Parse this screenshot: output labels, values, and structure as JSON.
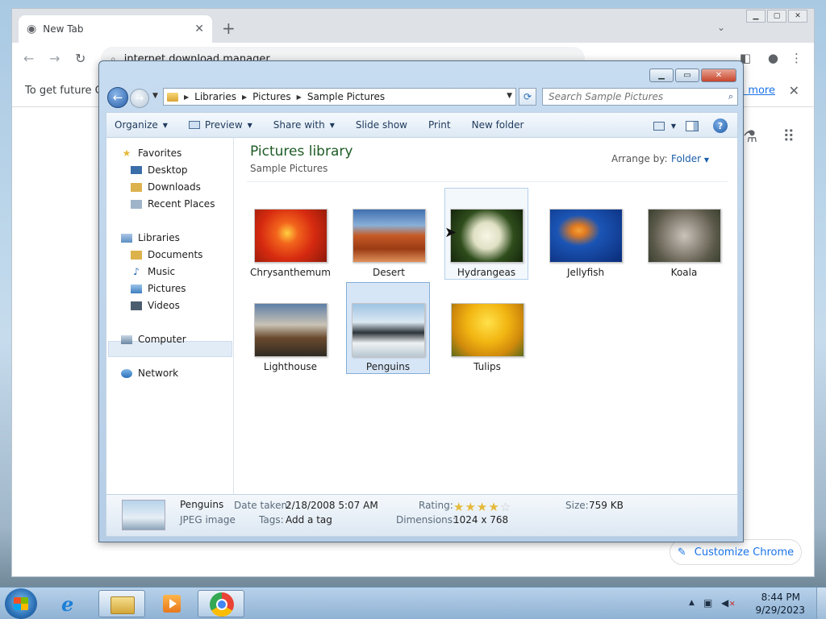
{
  "chrome": {
    "tab_title": "New Tab",
    "omnibox_text": "internet download manager",
    "info_message": "To get future Go",
    "info_link": "rn more",
    "customize_label": "Customize Chrome"
  },
  "explorer": {
    "breadcrumbs": [
      "Libraries",
      "Pictures",
      "Sample Pictures"
    ],
    "search_placeholder": "Search Sample Pictures",
    "commands": {
      "organize": "Organize",
      "preview": "Preview",
      "share_with": "Share with",
      "slide_show": "Slide show",
      "print": "Print",
      "new_folder": "New folder"
    },
    "nav": {
      "favorites": "Favorites",
      "desktop": "Desktop",
      "downloads": "Downloads",
      "recent_places": "Recent Places",
      "libraries": "Libraries",
      "documents": "Documents",
      "music": "Music",
      "pictures": "Pictures",
      "videos": "Videos",
      "computer": "Computer",
      "network": "Network"
    },
    "library_title": "Pictures library",
    "library_subtitle": "Sample Pictures",
    "arrange_by_label": "Arrange by:",
    "arrange_by_value": "Folder",
    "items": [
      {
        "name": "Chrysanthemum",
        "state": "normal"
      },
      {
        "name": "Desert",
        "state": "normal"
      },
      {
        "name": "Hydrangeas",
        "state": "hover"
      },
      {
        "name": "Jellyfish",
        "state": "normal"
      },
      {
        "name": "Koala",
        "state": "normal"
      },
      {
        "name": "Lighthouse",
        "state": "normal"
      },
      {
        "name": "Penguins",
        "state": "selected"
      },
      {
        "name": "Tulips",
        "state": "normal"
      }
    ],
    "details": {
      "name": "Penguins",
      "type": "JPEG image",
      "date_taken_label": "Date taken:",
      "date_taken": "2/18/2008 5:07 AM",
      "tags_label": "Tags:",
      "tags": "Add a tag",
      "rating_label": "Rating:",
      "rating_stars_filled": 4,
      "rating_stars_total": 5,
      "dimensions_label": "Dimensions:",
      "dimensions": "1024 x 768",
      "size_label": "Size:",
      "size": "759 KB"
    }
  },
  "taskbar": {
    "time": "8:44 PM",
    "date": "9/29/2023"
  }
}
